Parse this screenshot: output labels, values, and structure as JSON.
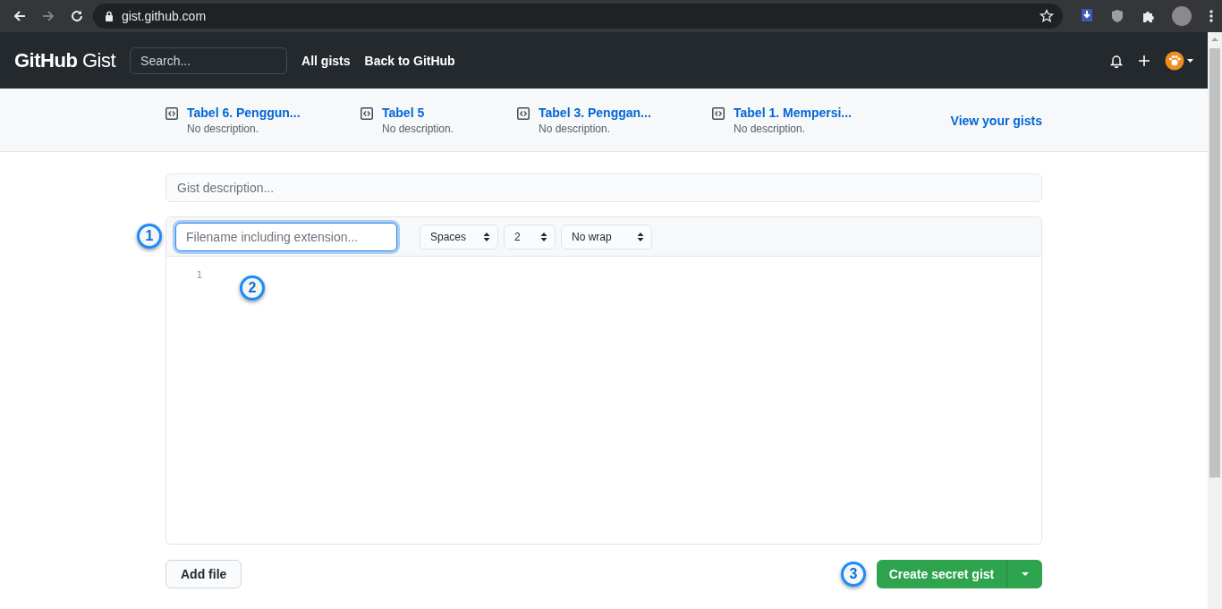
{
  "browser": {
    "url": "gist.github.com",
    "forward_disabled": true
  },
  "header": {
    "logo_bold": "GitHub",
    "logo_light": "Gist",
    "search": {
      "placeholder": "Search..."
    },
    "nav": [
      "All gists",
      "Back to GitHub"
    ]
  },
  "recent_gists": [
    {
      "title": "Tabel 6. Penggun...",
      "description": "No description."
    },
    {
      "title": "Tabel 5",
      "description": "No description."
    },
    {
      "title": "Tabel 3. Penggan...",
      "description": "No description."
    },
    {
      "title": "Tabel 1. Mempersi...",
      "description": "No description."
    }
  ],
  "view_link": "View your gists",
  "description_field": {
    "placeholder": "Gist description..."
  },
  "file": {
    "filename_placeholder": "Filename including extension...",
    "filename_focused": true,
    "selects": [
      "Spaces",
      "2",
      "No wrap"
    ],
    "line_numbers": [
      "1"
    ]
  },
  "annotations": [
    "1",
    "2",
    "3"
  ],
  "add_file": "Add file",
  "create_button": "Create secret gist"
}
